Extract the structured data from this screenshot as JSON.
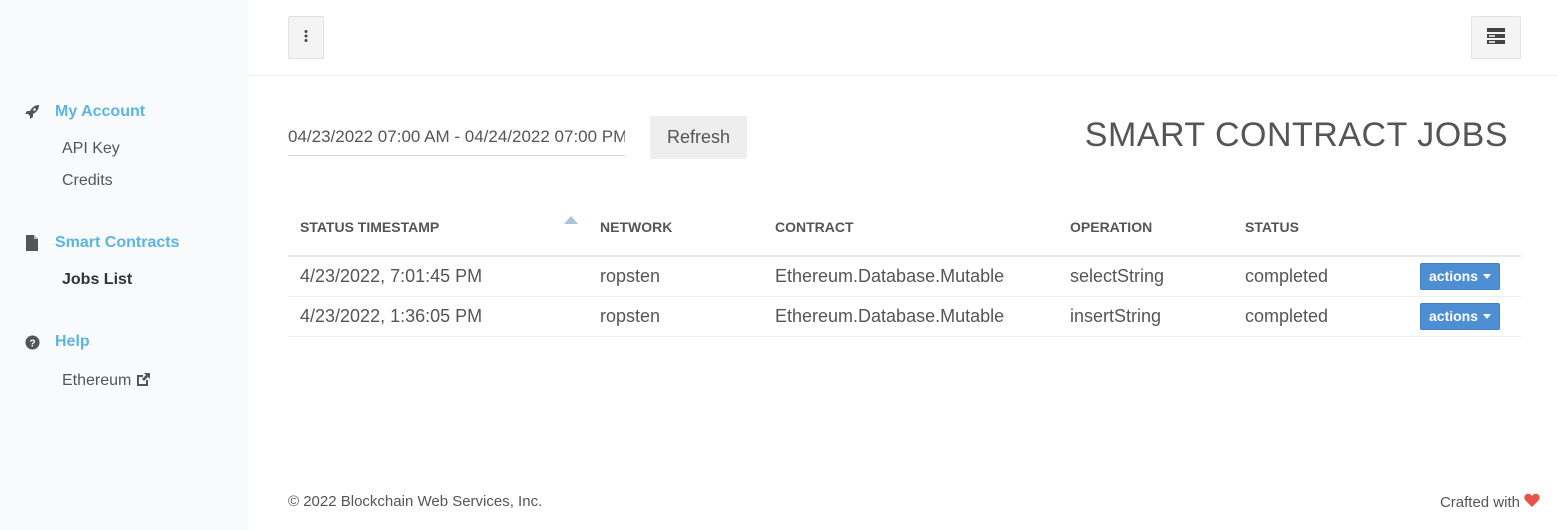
{
  "sidebar": {
    "account": {
      "label": "My Account",
      "items": [
        {
          "label": "API Key"
        },
        {
          "label": "Credits"
        }
      ]
    },
    "contracts": {
      "label": "Smart Contracts",
      "items": [
        {
          "label": "Jobs List"
        }
      ]
    },
    "help": {
      "label": "Help",
      "items": [
        {
          "label": "Ethereum"
        }
      ]
    }
  },
  "filters": {
    "date_range": "04/23/2022 07:00 AM - 04/24/2022 07:00 PM",
    "refresh_label": "Refresh"
  },
  "page": {
    "title": "SMART CONTRACT JOBS"
  },
  "table": {
    "headers": [
      "STATUS TIMESTAMP",
      "NETWORK",
      "CONTRACT",
      "OPERATION",
      "STATUS"
    ],
    "rows": [
      {
        "timestamp": "4/23/2022, 7:01:45 PM",
        "network": "ropsten",
        "contract": "Ethereum.Database.Mutable",
        "operation": "selectString",
        "status": "completed",
        "actions": "actions"
      },
      {
        "timestamp": "4/23/2022, 1:36:05 PM",
        "network": "ropsten",
        "contract": "Ethereum.Database.Mutable",
        "operation": "insertString",
        "status": "completed",
        "actions": "actions"
      }
    ]
  },
  "footer": {
    "copyright": "© 2022 Blockchain Web Services, Inc.",
    "crafted": "Crafted with"
  },
  "colors": {
    "accent": "#5bb5e0",
    "button_primary": "#4e8fd4",
    "heart": "#e8534a",
    "sidebar_bg": "#f8fafb"
  },
  "icons": {
    "account": "rocket-icon",
    "contracts": "file-icon",
    "help": "question-circle-icon",
    "external": "external-link-icon",
    "kebab": "vertical-dots-icon",
    "layout": "layout-toggle-icon",
    "heart": "heart-icon"
  }
}
